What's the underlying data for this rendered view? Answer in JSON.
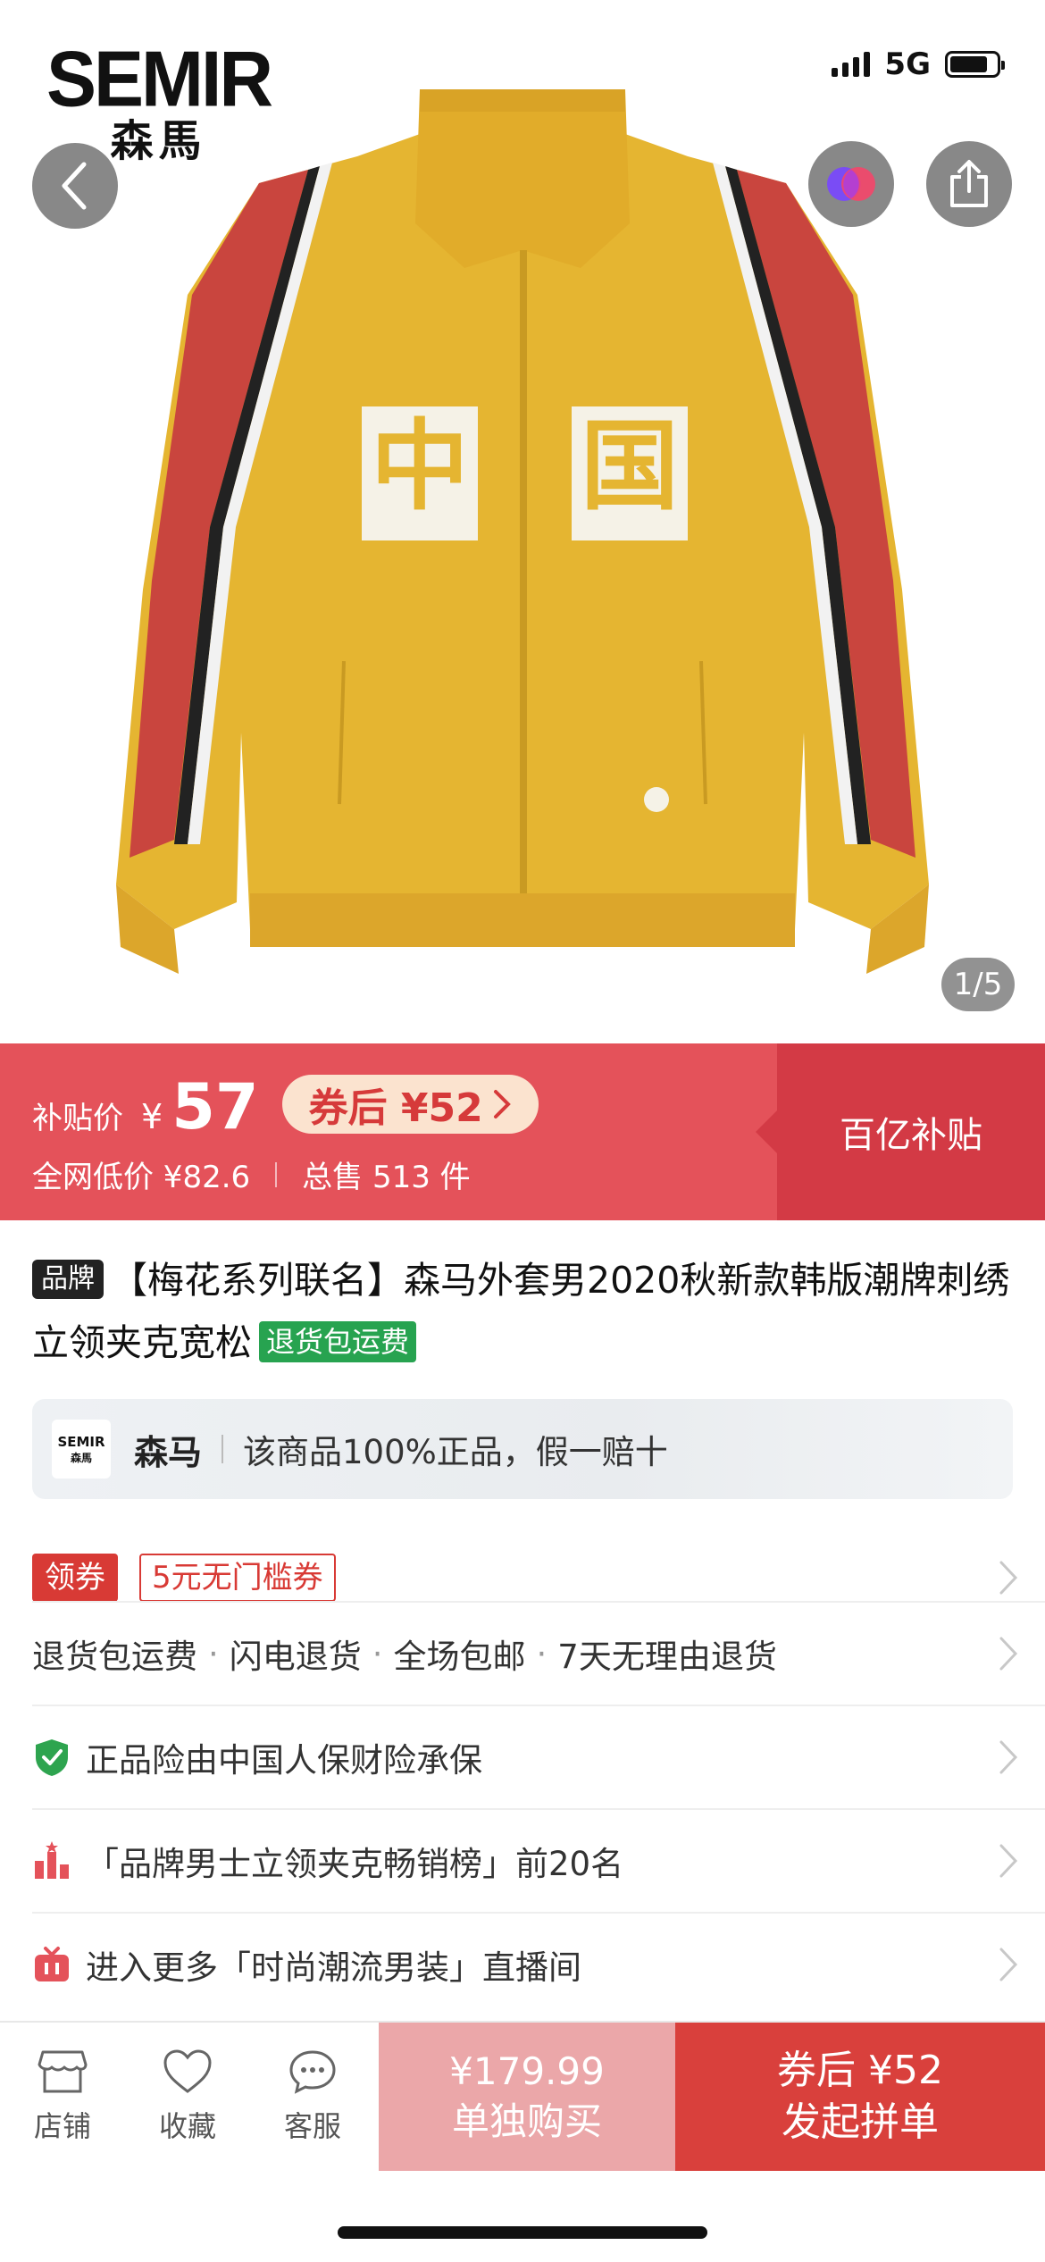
{
  "status_bar": {
    "network": "5G"
  },
  "hero": {
    "brand_logo_en": "SEMIR",
    "brand_logo_cn": "森馬",
    "image_counter": "1/5",
    "jacket_patches": [
      "中",
      "国"
    ],
    "colors": {
      "jacket": "#e5b531",
      "stripe_red": "#c9453e"
    }
  },
  "price": {
    "label": "补贴价",
    "currency": "¥",
    "value": "57",
    "coupon_pill": "券后 ¥52",
    "lowest_price": "全网低价 ¥82.6",
    "total_sold": "总售 513 件",
    "side_badge": "百亿补贴",
    "colors": {
      "bar": "#e4525a",
      "side": "#d33a45"
    }
  },
  "product": {
    "brand_tag": "品牌",
    "title": "【梅花系列联名】森马外套男2020秋新款韩版潮牌刺绣立领夹克宽松",
    "return_tag": "退货包运费"
  },
  "brand_strip": {
    "logo_en": "SEMIR",
    "logo_cn": "森馬",
    "name": "森马",
    "description": "该商品100%正品，假一赔十"
  },
  "coupon_row": {
    "button": "领券",
    "coupon": "5元无门槛券"
  },
  "service_row": {
    "items": [
      "退货包运费",
      "闪电退货",
      "全场包邮",
      "7天无理由退货"
    ]
  },
  "insurance_row": {
    "text": "正品险由中国人保财险承保"
  },
  "ranking_row": {
    "text": "「品牌男士立领夹克畅销榜」前20名"
  },
  "live_row": {
    "text": "进入更多「时尚潮流男装」直播间"
  },
  "bottom_bar": {
    "store": "店铺",
    "favorite": "收藏",
    "service": "客服",
    "single_price": "¥179.99",
    "single_label": "单独购买",
    "group_price": "券后 ¥52",
    "group_label": "发起拼单"
  }
}
